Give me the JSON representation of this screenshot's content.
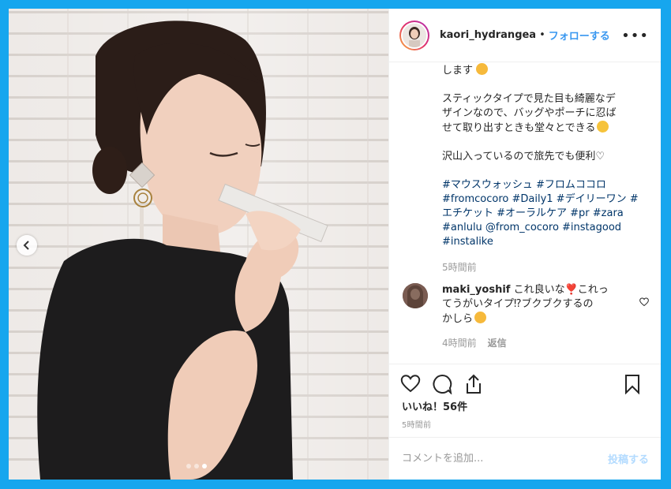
{
  "post": {
    "username": "kaori_hydrangea",
    "bullet": "•",
    "follow_label": "フォローする",
    "more_label": "•••"
  },
  "caption": {
    "line1": "します",
    "para2_l1": "スティックタイプで見た目も綺麗なデ",
    "para2_l2": "ザインなので、バッグやポーチに忍ば",
    "para2_l3": "せて取り出すときも堂々とできる",
    "para3": "沢山入っているので旅先でも便利♡",
    "tags_l1": "#マウスウォッシュ #フロムココロ",
    "tags_l2": "#fromcocoro #Daily1 #デイリーワン #",
    "tags_l3": "エチケット #オーラルケア #pr #zara",
    "tags_l4": "#anlulu @from_cocoro #instagood",
    "tags_l5": "#instalike",
    "time": "5時間前"
  },
  "reply": {
    "username": "maki_yoshif",
    "text_l1": "これ良いな❣️これっ",
    "text_l2": "てうがいタイプ⁉︎ブクブクするの",
    "text_l3": "かしら",
    "time": "4時間前",
    "reply_label": "返信"
  },
  "stats": {
    "likes": "いいね！56件",
    "post_time": "5時間前"
  },
  "comment_box": {
    "placeholder": "コメントを追加...",
    "submit_label": "投稿する"
  },
  "colors": {
    "frame": "#16a6ee",
    "link": "#3897f0",
    "hashtag": "#003569",
    "muted": "#999999"
  },
  "icons": [
    "chevron-left-icon",
    "heart-icon",
    "comment-icon",
    "share-icon",
    "bookmark-icon",
    "more-icon"
  ],
  "carousel": {
    "count": 3,
    "active_index": 2
  }
}
